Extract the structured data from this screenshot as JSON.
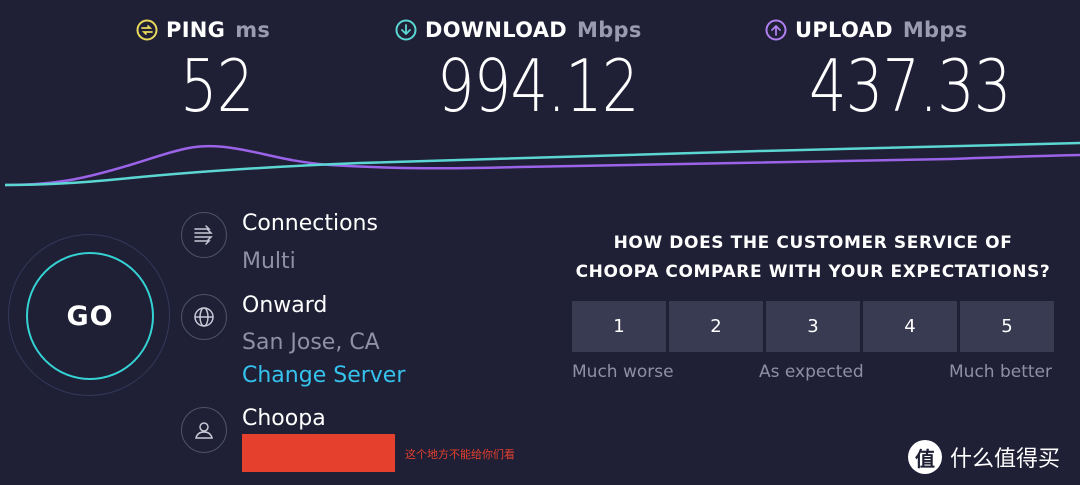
{
  "metrics": {
    "ping": {
      "label": "PING",
      "unit": "ms",
      "value": "52",
      "color": "#e8d95b",
      "icon": "ping-icon"
    },
    "download": {
      "label": "DOWNLOAD",
      "unit": "Mbps",
      "value": "994.12",
      "color": "#5bd6d2",
      "icon": "download-arrow-icon"
    },
    "upload": {
      "label": "UPLOAD",
      "unit": "Mbps",
      "value": "437.33",
      "color": "#b07ff0",
      "icon": "upload-arrow-icon"
    }
  },
  "go_button": {
    "label": "GO"
  },
  "connections": {
    "title": "Connections",
    "value": "Multi",
    "icon": "connections-icon"
  },
  "server": {
    "isp": "Onward",
    "location": "San Jose, CA",
    "change_link": "Change Server",
    "icon": "globe-icon"
  },
  "host": {
    "name": "Choopa",
    "icon": "user-icon"
  },
  "redaction_note": "这个地方不能给你们看",
  "survey": {
    "question_line1": "HOW DOES THE CUSTOMER SERVICE OF",
    "question_line2": "CHOOPA COMPARE WITH YOUR EXPECTATIONS?",
    "options": [
      "1",
      "2",
      "3",
      "4",
      "5"
    ],
    "scale_low": "Much worse",
    "scale_mid": "As expected",
    "scale_high": "Much better"
  },
  "watermark": {
    "logo": "值",
    "text": "什么值得买"
  },
  "colors": {
    "background": "#1f1f35",
    "accent": "#35d2d3",
    "download_line": "#5bd6d2",
    "upload_line": "#9b63e8",
    "link": "#35c3ee"
  }
}
